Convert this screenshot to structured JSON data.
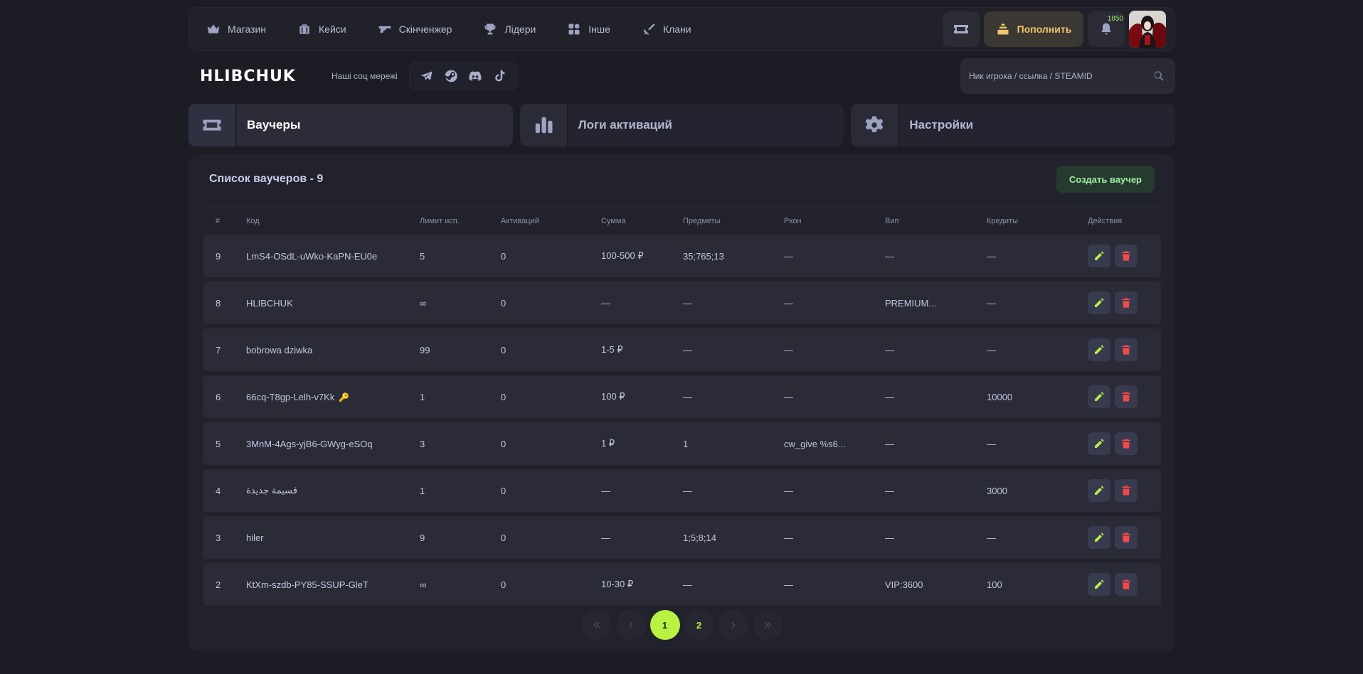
{
  "nav": {
    "items": [
      {
        "label": "Магазин",
        "icon": "crown-icon"
      },
      {
        "label": "Кейси",
        "icon": "case-icon"
      },
      {
        "label": "Скінченжер",
        "icon": "gun-icon"
      },
      {
        "label": "Лідери",
        "icon": "trophy-icon"
      },
      {
        "label": "Інше",
        "icon": "grid-icon"
      },
      {
        "label": "Клани",
        "icon": "swords-icon"
      }
    ],
    "topup_label": "Пополнить",
    "notification_count": "1850"
  },
  "header": {
    "logo": "HLIBCHUK",
    "socials_label": "Наші соц мережі",
    "socials": [
      "telegram-icon",
      "steam-icon",
      "discord-icon",
      "tiktok-icon"
    ],
    "search_placeholder": "Ник игрока / ссылка / STEAMID"
  },
  "tabs": [
    {
      "label": "Ваучеры",
      "icon": "ticket-icon",
      "active": true
    },
    {
      "label": "Логи активаций",
      "icon": "bar-chart-icon",
      "active": false
    },
    {
      "label": "Настройки",
      "icon": "gear-icon",
      "active": false
    }
  ],
  "panel": {
    "title": "Список ваучеров - 9",
    "create_label": "Создать ваучер"
  },
  "table": {
    "columns": [
      "#",
      "Код",
      "Лимит исп.",
      "Активаций",
      "Сумма",
      "Предметы",
      "Ркон",
      "Вип",
      "Кредиты",
      "Действия"
    ],
    "rows": [
      {
        "id": "9",
        "code": "LmS4-OSdL-uWko-KaPN-EU0e",
        "limit": "5",
        "activations": "0",
        "sum": "100-500 ₽",
        "items": "35;765;13",
        "rcon": "—",
        "vip": "—",
        "credits": "—",
        "key": false
      },
      {
        "id": "8",
        "code": "HLIBCHUK",
        "limit": "∞",
        "activations": "0",
        "sum": "—",
        "items": "—",
        "rcon": "—",
        "vip": "PREMIUM...",
        "credits": "—",
        "key": false
      },
      {
        "id": "7",
        "code": "bobrowa dziwka",
        "limit": "99",
        "activations": "0",
        "sum": "1-5 ₽",
        "items": "—",
        "rcon": "—",
        "vip": "—",
        "credits": "—",
        "key": false
      },
      {
        "id": "6",
        "code": "66cq-T8gp-Lelh-v7Kk",
        "limit": "1",
        "activations": "0",
        "sum": "100 ₽",
        "items": "—",
        "rcon": "—",
        "vip": "—",
        "credits": "10000",
        "key": true
      },
      {
        "id": "5",
        "code": "3MnM-4Ags-yjB6-GWyg-eSOq",
        "limit": "3",
        "activations": "0",
        "sum": "1 ₽",
        "items": "1",
        "rcon": "cw_give %s6...",
        "vip": "—",
        "credits": "—",
        "key": false
      },
      {
        "id": "4",
        "code": "قسيمة جديدة",
        "limit": "1",
        "activations": "0",
        "sum": "—",
        "items": "—",
        "rcon": "—",
        "vip": "—",
        "credits": "3000",
        "key": false
      },
      {
        "id": "3",
        "code": "hiler",
        "limit": "9",
        "activations": "0",
        "sum": "—",
        "items": "1;5;8;14",
        "rcon": "—",
        "vip": "—",
        "credits": "—",
        "key": false
      },
      {
        "id": "2",
        "code": "KtXm-szdb-PY85-SSUP-GleT",
        "limit": "∞",
        "activations": "0",
        "sum": "10-30 ₽",
        "items": "—",
        "rcon": "—",
        "vip": "VIP:3600",
        "credits": "100",
        "key": false
      }
    ]
  },
  "pagination": {
    "pages": [
      "1",
      "2"
    ],
    "current": "1"
  },
  "colors": {
    "background": "#1c1d24",
    "accent_green": "#b8f243",
    "gold": "#f0c46c",
    "danger": "#f04a4a"
  }
}
